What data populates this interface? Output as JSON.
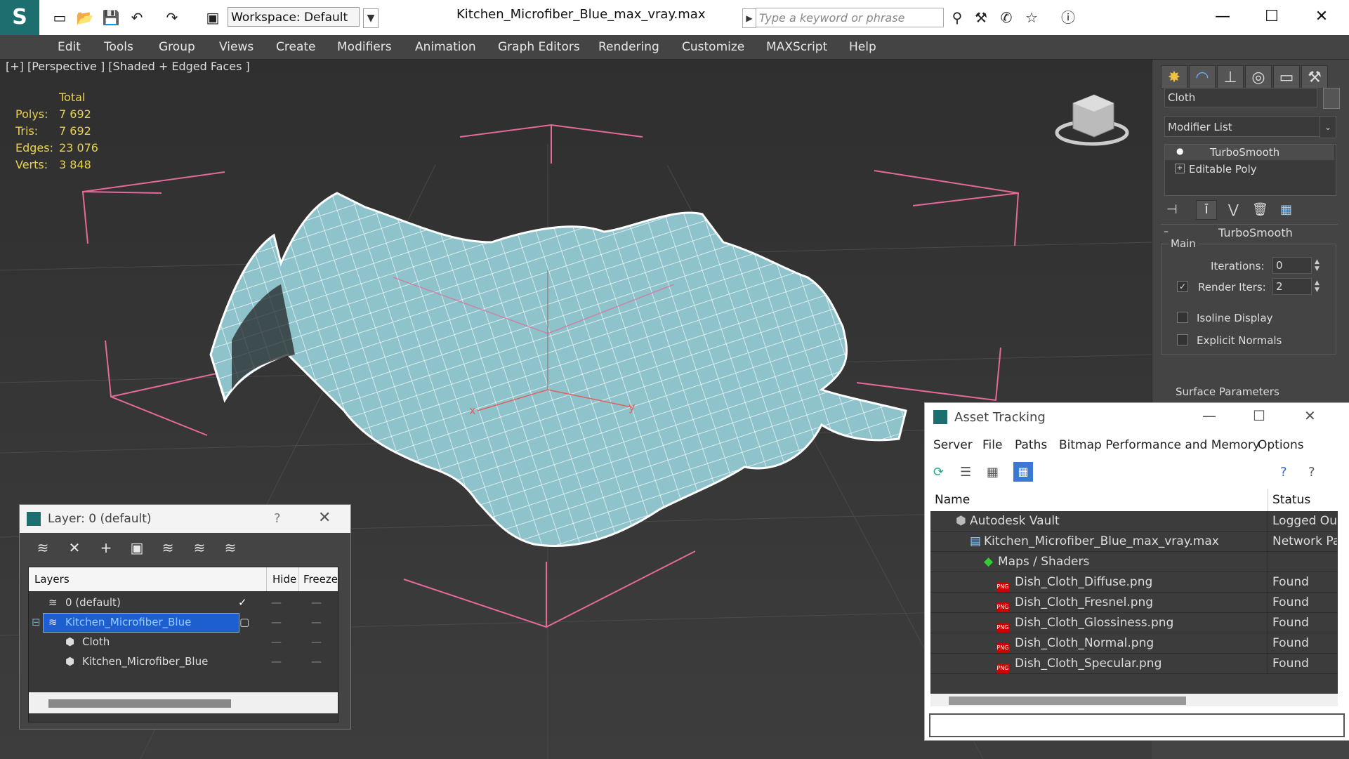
{
  "titlebar": {
    "workspace": "Workspace: Default",
    "file_title": "Kitchen_Microfiber_Blue_max_vray.max",
    "search_placeholder": "Type a keyword or phrase"
  },
  "menu": [
    "Edit",
    "Tools",
    "Group",
    "Views",
    "Create",
    "Modifiers",
    "Animation",
    "Graph Editors",
    "Rendering",
    "Customize",
    "MAXScript",
    "Help"
  ],
  "viewport": {
    "label": "[+] [Perspective ] [Shaded + Edged Faces ]",
    "stats": {
      "total_label": "Total",
      "rows": [
        {
          "label": "Polys:",
          "value": "7 692"
        },
        {
          "label": "Tris:",
          "value": "7 692"
        },
        {
          "label": "Edges:",
          "value": "23 076"
        },
        {
          "label": "Verts:",
          "value": "3 848"
        }
      ]
    },
    "axis_x": "x",
    "axis_y": "y",
    "mesh_color": "#9fd0d6"
  },
  "command_panel": {
    "object_name": "Cloth",
    "modifier_list": "Modifier List",
    "stack": [
      "TurboSmooth",
      "Editable Poly"
    ],
    "rollout_title": "TurboSmooth",
    "main_label": "Main",
    "iterations_label": "Iterations:",
    "iterations_value": "0",
    "render_iters_label": "Render Iters:",
    "render_iters_value": "2",
    "isoline_label": "Isoline Display",
    "explicit_normals_label": "Explicit Normals",
    "surface_params_label": "Surface Parameters"
  },
  "layer_window": {
    "title": "Layer: 0 (default)",
    "help": "?",
    "col_layers": "Layers",
    "col_hide": "Hide",
    "col_freeze": "Freeze",
    "rows": [
      {
        "name": "0 (default)"
      },
      {
        "name": "Kitchen_Microfiber_Blue"
      },
      {
        "name": "Cloth"
      },
      {
        "name": "Kitchen_Microfiber_Blue"
      }
    ]
  },
  "asset_window": {
    "title": "Asset Tracking",
    "menus": [
      "Server",
      "File",
      "Paths",
      "Bitmap Performance and Memory",
      "Options"
    ],
    "col_name": "Name",
    "col_status": "Status",
    "rows": [
      {
        "name": "Autodesk Vault",
        "status": "Logged Ou"
      },
      {
        "name": "Kitchen_Microfiber_Blue_max_vray.max",
        "status": "Network Pa"
      },
      {
        "name": "Maps / Shaders",
        "status": ""
      },
      {
        "name": "Dish_Cloth_Diffuse.png",
        "status": "Found"
      },
      {
        "name": "Dish_Cloth_Fresnel.png",
        "status": "Found"
      },
      {
        "name": "Dish_Cloth_Glossiness.png",
        "status": "Found"
      },
      {
        "name": "Dish_Cloth_Normal.png",
        "status": "Found"
      },
      {
        "name": "Dish_Cloth_Specular.png",
        "status": "Found"
      }
    ]
  }
}
